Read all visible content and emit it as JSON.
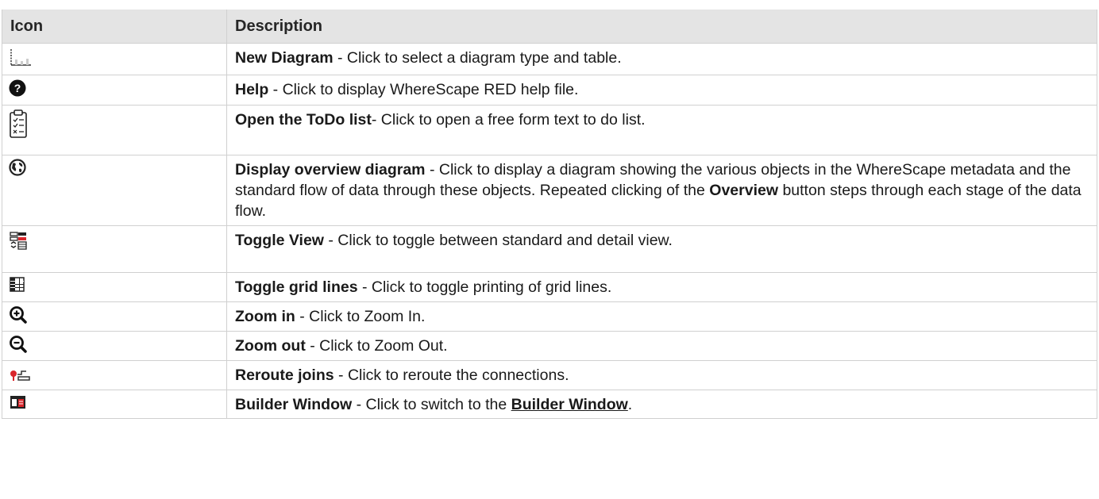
{
  "table": {
    "headers": {
      "icon": "Icon",
      "description": "Description"
    },
    "rows": [
      {
        "icon": "new-diagram-icon",
        "title": "New Diagram",
        "text": " - Click to select a diagram type and table."
      },
      {
        "icon": "help-icon",
        "title": "Help",
        "text": " - Click to display WhereScape RED help file."
      },
      {
        "icon": "todo-list-icon",
        "title": "Open the ToDo list",
        "text": "- Click to open a free form text to do list."
      },
      {
        "icon": "globe-icon",
        "title": "Display overview diagram",
        "text": " - Click to display a diagram showing the various objects in the WhereScape metadata and the standard flow of data through these objects. Repeated clicking of the ",
        "bold2": "Overview",
        "text2": " button steps through each stage of the data flow."
      },
      {
        "icon": "toggle-view-icon",
        "title": "Toggle View",
        "text": " - Click to toggle between standard and detail view."
      },
      {
        "icon": "grid-lines-icon",
        "title": "Toggle grid lines",
        "text": " - Click to toggle printing of grid lines."
      },
      {
        "icon": "zoom-in-icon",
        "title": "Zoom in",
        "text": " - Click to Zoom In."
      },
      {
        "icon": "zoom-out-icon",
        "title": "Zoom out",
        "text": " - Click to Zoom Out."
      },
      {
        "icon": "reroute-joins-icon",
        "title": "Reroute joins",
        "text": " - Click to reroute the connections."
      },
      {
        "icon": "builder-window-icon",
        "title": "Builder Window",
        "text": "  -  Click to switch to the ",
        "link": "Builder Window",
        "text2": "."
      }
    ]
  },
  "colors": {
    "header_bg": "#e4e4e4",
    "border": "#d0d0d0",
    "accent_red": "#d9262b"
  }
}
